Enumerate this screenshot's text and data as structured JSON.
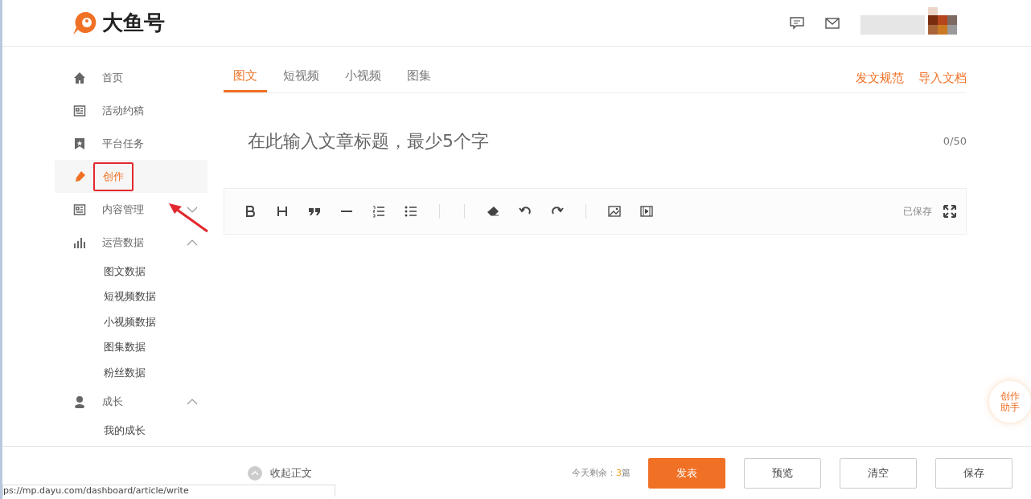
{
  "header": {
    "logo": "大鱼号"
  },
  "sidebar": {
    "items": [
      {
        "label": "首页",
        "kind": "home",
        "selected": false,
        "annotated": false
      },
      {
        "label": "活动约稿",
        "kind": "doc",
        "selected": false,
        "annotated": false
      },
      {
        "label": "平台任务",
        "kind": "star",
        "selected": false,
        "annotated": false
      },
      {
        "label": "创作",
        "kind": "pen",
        "selected": true,
        "annotated": true
      },
      {
        "label": "内容管理",
        "kind": "doc",
        "selected": false,
        "annotated": false,
        "expanded": false
      },
      {
        "label": "运营数据",
        "kind": "bars",
        "selected": false,
        "annotated": false,
        "expanded": true,
        "children": [
          {
            "label": "图文数据"
          },
          {
            "label": "短视频数据"
          },
          {
            "label": "小视频数据"
          },
          {
            "label": "图集数据"
          },
          {
            "label": "粉丝数据"
          }
        ]
      },
      {
        "label": "成长",
        "kind": "user",
        "selected": false,
        "annotated": false,
        "expanded": true,
        "children": [
          {
            "label": "我的成长"
          }
        ]
      }
    ]
  },
  "tabs": [
    {
      "label": "图文",
      "selected": true
    },
    {
      "label": "短视频",
      "selected": false
    },
    {
      "label": "小视频",
      "selected": false
    },
    {
      "label": "图集",
      "selected": false
    }
  ],
  "tab_links": [
    "发文规范",
    "导入文档"
  ],
  "title_field": {
    "placeholder": "在此输入文章标题，最少5个字",
    "counter": "0/50"
  },
  "toolbar": {
    "tools": [
      {
        "kind": "bold"
      },
      {
        "kind": "heading"
      },
      {
        "kind": "quote"
      },
      {
        "kind": "rule"
      },
      {
        "kind": "ordered-list"
      },
      {
        "kind": "bullet-list"
      },
      {
        "kind": "sep"
      },
      {
        "kind": "sep"
      },
      {
        "kind": "eraser"
      },
      {
        "kind": "undo"
      },
      {
        "kind": "redo"
      },
      {
        "kind": "sep"
      },
      {
        "kind": "image"
      },
      {
        "kind": "video"
      }
    ],
    "status": "已保存"
  },
  "assistant": [
    "创作",
    "助手"
  ],
  "footer": {
    "collapse": "收起正文",
    "remaining_label": "今天剩余：",
    "remaining_count": "3",
    "remaining_unit": "篇",
    "buttons": [
      {
        "label": "发表",
        "primary": true
      },
      {
        "label": "预览",
        "primary": false
      },
      {
        "label": "清空",
        "primary": false
      },
      {
        "label": "保存",
        "primary": false
      }
    ]
  },
  "status_url": "ps://mp.dayu.com/dashboard/article/write"
}
